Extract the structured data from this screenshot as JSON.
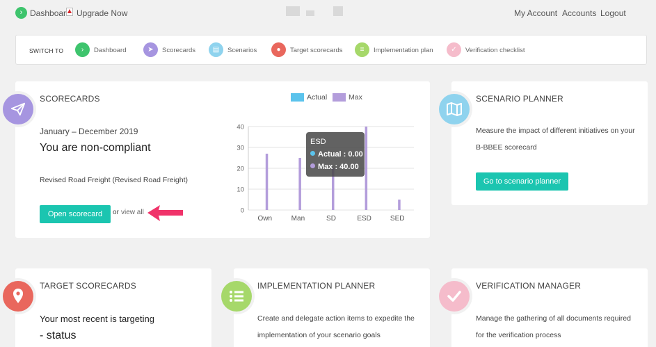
{
  "topnav": {
    "dashboard": "Dashboard",
    "upgrade": "Upgrade Now",
    "my_account": "My Account",
    "accounts": "Accounts",
    "logout": "Logout"
  },
  "switchbar": {
    "label": "SWITCH TO",
    "items": [
      {
        "label": "Dashboard",
        "icon": "chevron-right-icon",
        "color": "#3ec46d"
      },
      {
        "label": "Scorecards",
        "icon": "paper-plane-icon",
        "color": "#a695e0"
      },
      {
        "label": "Scenarios",
        "icon": "map-icon",
        "color": "#8fd3ee"
      },
      {
        "label": "Target scorecards",
        "icon": "location-pin-icon",
        "color": "#e9675d"
      },
      {
        "label": "Implementation plan",
        "icon": "list-icon",
        "color": "#a6d86a"
      },
      {
        "label": "Verification checklist",
        "icon": "check-icon",
        "color": "#f5bccb"
      }
    ]
  },
  "scorecards": {
    "title": "SCORECARDS",
    "period": "January – December 2019",
    "status": "You are non-compliant",
    "scorecard_name": "Revised Road Freight (Revised Road Freight)",
    "open_button": "Open scorecard",
    "or_text": "or",
    "view_all": "view all",
    "icon_color": "#a695e0"
  },
  "chart_data": {
    "type": "bar",
    "categories": [
      "Own",
      "Man",
      "SD",
      "ESD",
      "SED"
    ],
    "series": [
      {
        "name": "Actual",
        "values": [
          0,
          0,
          0,
          0,
          0
        ],
        "color": "#5bc3ec"
      },
      {
        "name": "Max",
        "values": [
          27,
          25,
          20,
          40,
          5
        ],
        "color": "#b39ddb"
      }
    ],
    "ylim": [
      0,
      40
    ],
    "yticks": [
      0,
      10,
      20,
      30,
      40
    ],
    "grid": true,
    "legend": "top",
    "tooltip": {
      "title": "ESD",
      "rows": [
        "Actual : 0.00",
        "Max : 40.00"
      ]
    }
  },
  "scenario_planner": {
    "title": "SCENARIO PLANNER",
    "line1": "Measure the impact of different initiatives on your",
    "line2": "B-BBEE scorecard",
    "button": "Go to scenario planner",
    "icon_color": "#8fd3ee"
  },
  "target_scorecards": {
    "title": "TARGET SCORECARDS",
    "line1": "Your most recent is targeting",
    "line2": "- status",
    "icon_color": "#e9675d"
  },
  "implementation_planner": {
    "title": "IMPLEMENTATION PLANNER",
    "line1": "Create and delegate action items to expedite the",
    "line2": "implementation of your scenario goals",
    "icon_color": "#a6d86a"
  },
  "verification_manager": {
    "title": "VERIFICATION MANAGER",
    "line1": "Manage the gathering of all documents required",
    "line2": "for the verification process",
    "icon_color": "#f5bccb"
  },
  "annotation": {
    "arrow_color": "#f0336a"
  }
}
